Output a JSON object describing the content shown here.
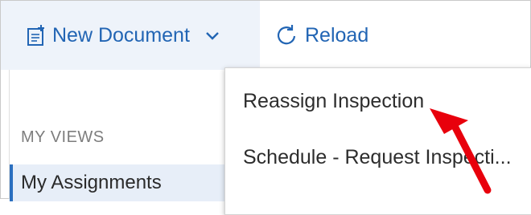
{
  "toolbar": {
    "new_document_label": "New Document",
    "reload_label": "Reload",
    "accent": "#2265b4"
  },
  "sidebar": {
    "heading": "MY VIEWS",
    "items": [
      {
        "label": "My Assignments",
        "selected": true
      }
    ]
  },
  "menu": {
    "items": [
      {
        "label": "Reassign Inspection"
      },
      {
        "label": "Schedule - Request Inspecti..."
      }
    ]
  },
  "annotation": {
    "color": "#e8000c",
    "icon": "red-pointer-arrow"
  }
}
